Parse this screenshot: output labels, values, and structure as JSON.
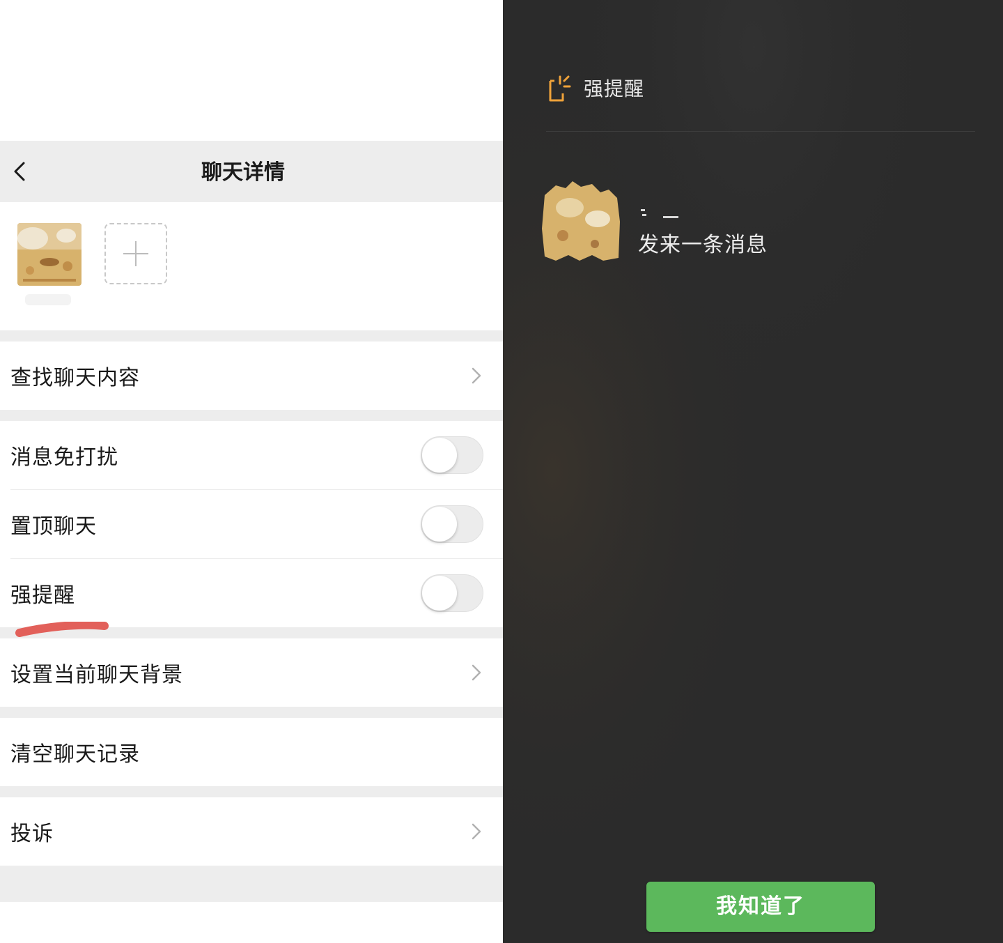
{
  "left": {
    "nav": {
      "title": "聊天详情",
      "back_icon": "chevron-left-icon"
    },
    "rows": {
      "search_history": "查找聊天内容",
      "mute": "消息免打扰",
      "sticky": "置顶聊天",
      "strong_remind": "强提醒",
      "background": "设置当前聊天背景",
      "clear_history": "清空聊天记录",
      "report": "投诉"
    },
    "toggles": {
      "mute": false,
      "sticky": false,
      "strong_remind": false
    }
  },
  "right": {
    "header_title": "强提醒",
    "header_icon": "strong-remind-icon",
    "message_text": "发来一条消息",
    "ok_button": "我知道了"
  },
  "colors": {
    "nav_bg": "#ededed",
    "dark_bg": "#2b2b2b",
    "accent_orange": "#f0a33a",
    "button_green": "#5cb85c",
    "annotation_red": "#e2605a"
  }
}
